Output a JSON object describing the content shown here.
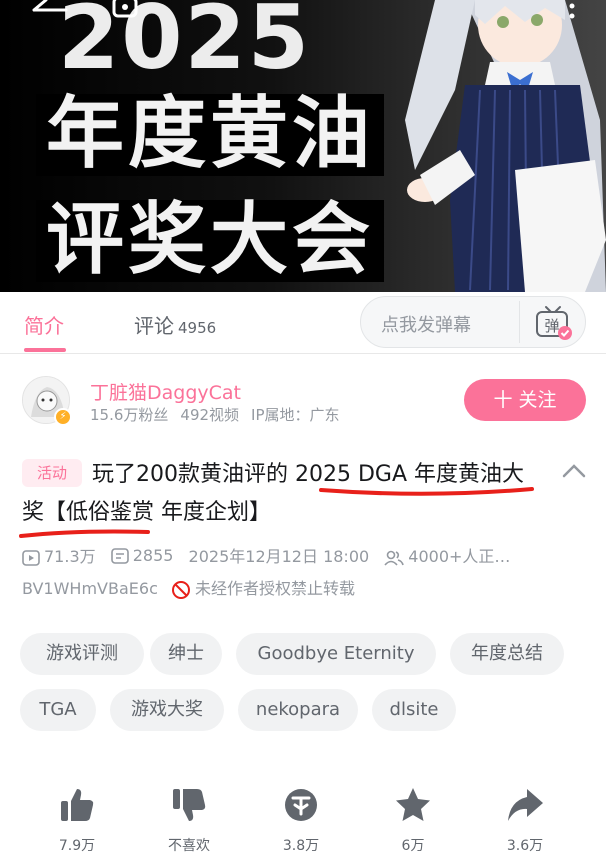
{
  "cover": {
    "year": "2025",
    "line1": "年度黄油",
    "line2": "评奖大会"
  },
  "tabs": {
    "intro": "简介",
    "comments": "评论",
    "comments_count": "4956"
  },
  "danmaku": {
    "placeholder": "点我发弹幕",
    "button": "弹"
  },
  "uploader": {
    "name": "丁脏猫DaggyCat",
    "fans": "15.6万粉丝",
    "videos": "492视频",
    "ip": "IP属地：广东",
    "follow_label": "十 关注"
  },
  "video": {
    "activity_tag": "活动",
    "title": "玩了200款黄油评的 2025 DGA 年度黄油大奖【低俗鉴赏 年度企划】",
    "views": "71.3万",
    "danmaku_count": "2855",
    "date": "2025年12月12日 18:00",
    "watching": "4000+人正…",
    "bvid": "BV1WHmVBaE6c",
    "copyright": "未经作者授权禁止转载"
  },
  "tags": [
    "游戏评测",
    "绅士",
    "Goodbye Eternity",
    "年度总结",
    "TGA",
    "游戏大奖",
    "nekopara",
    "dlsite"
  ],
  "actions": {
    "like": "7.9万",
    "dislike": "不喜欢",
    "coin": "3.8万",
    "favorite": "6万",
    "share": "3.6万"
  },
  "colors": {
    "accent": "#fb7299",
    "muted": "#9499a0",
    "annotation": "#e8201a"
  }
}
